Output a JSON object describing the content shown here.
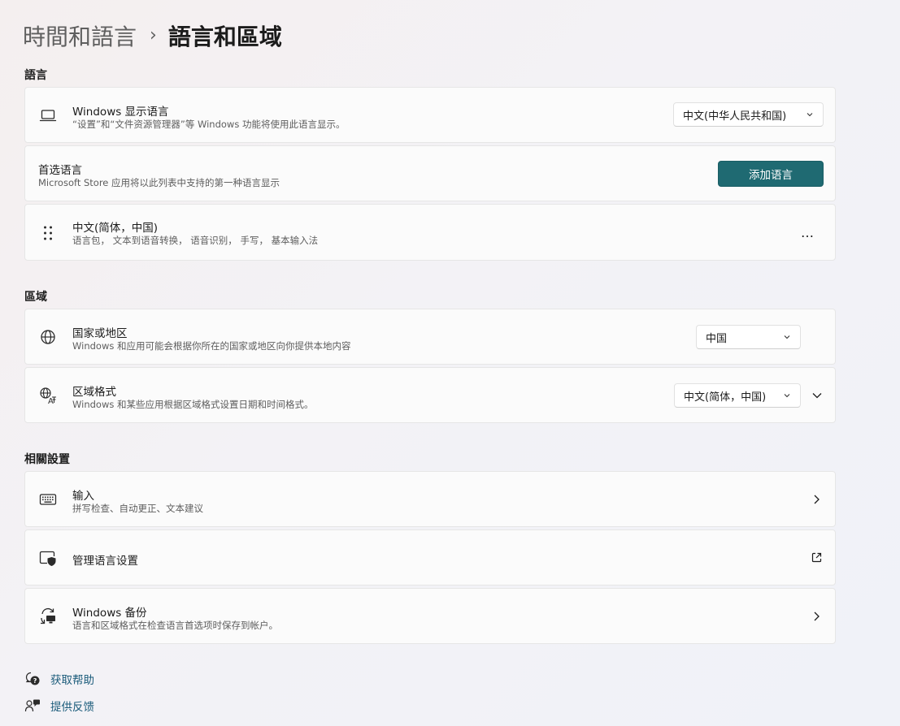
{
  "breadcrumb": {
    "parent": "時間和語言",
    "separator": "›",
    "current": "語言和區域"
  },
  "sections": {
    "language": "語言",
    "region": "區域",
    "related": "相關設置"
  },
  "display_language": {
    "icon": "laptop-icon",
    "title": "Windows 显示语言",
    "subtitle": "“设置”和“文件资源管理器”等 Windows 功能将使用此语言显示。",
    "selected": "中文(中华人民共和国)"
  },
  "preferred_languages": {
    "title": "首选语言",
    "subtitle": "Microsoft Store 应用将以此列表中支持的第一种语言显示",
    "add_button": "添加语言"
  },
  "language_item": {
    "icon": "drag-handle-icon",
    "title": "中文(简体，中国)",
    "subtitle": "语言包， 文本到语音转换， 语音识别， 手写， 基本输入法",
    "more": "…"
  },
  "country": {
    "icon": "globe-icon",
    "title": "国家或地区",
    "subtitle": "Windows 和应用可能会根据你所在的国家或地区向你提供本地内容",
    "selected": "中国"
  },
  "regional_format": {
    "icon": "regional-format-icon",
    "title": "区域格式",
    "subtitle": "Windows 和某些应用根据区域格式设置日期和时间格式。",
    "selected": "中文(简体，中国)"
  },
  "typing": {
    "icon": "keyboard-icon",
    "title": "输入",
    "subtitle": "拼写检查、自动更正、文本建议"
  },
  "admin_language": {
    "icon": "shield-window-icon",
    "title": "管理语言设置"
  },
  "backup": {
    "icon": "sync-backup-icon",
    "title": "Windows 备份",
    "subtitle": "语言和区域格式在检查语言首选项时保存到帐户。"
  },
  "footer": {
    "help": "获取帮助",
    "feedback": "提供反馈"
  },
  "colors": {
    "accent": "#1f6a72",
    "link": "#1a5b7a",
    "card_bg": "#fbfbfb"
  }
}
